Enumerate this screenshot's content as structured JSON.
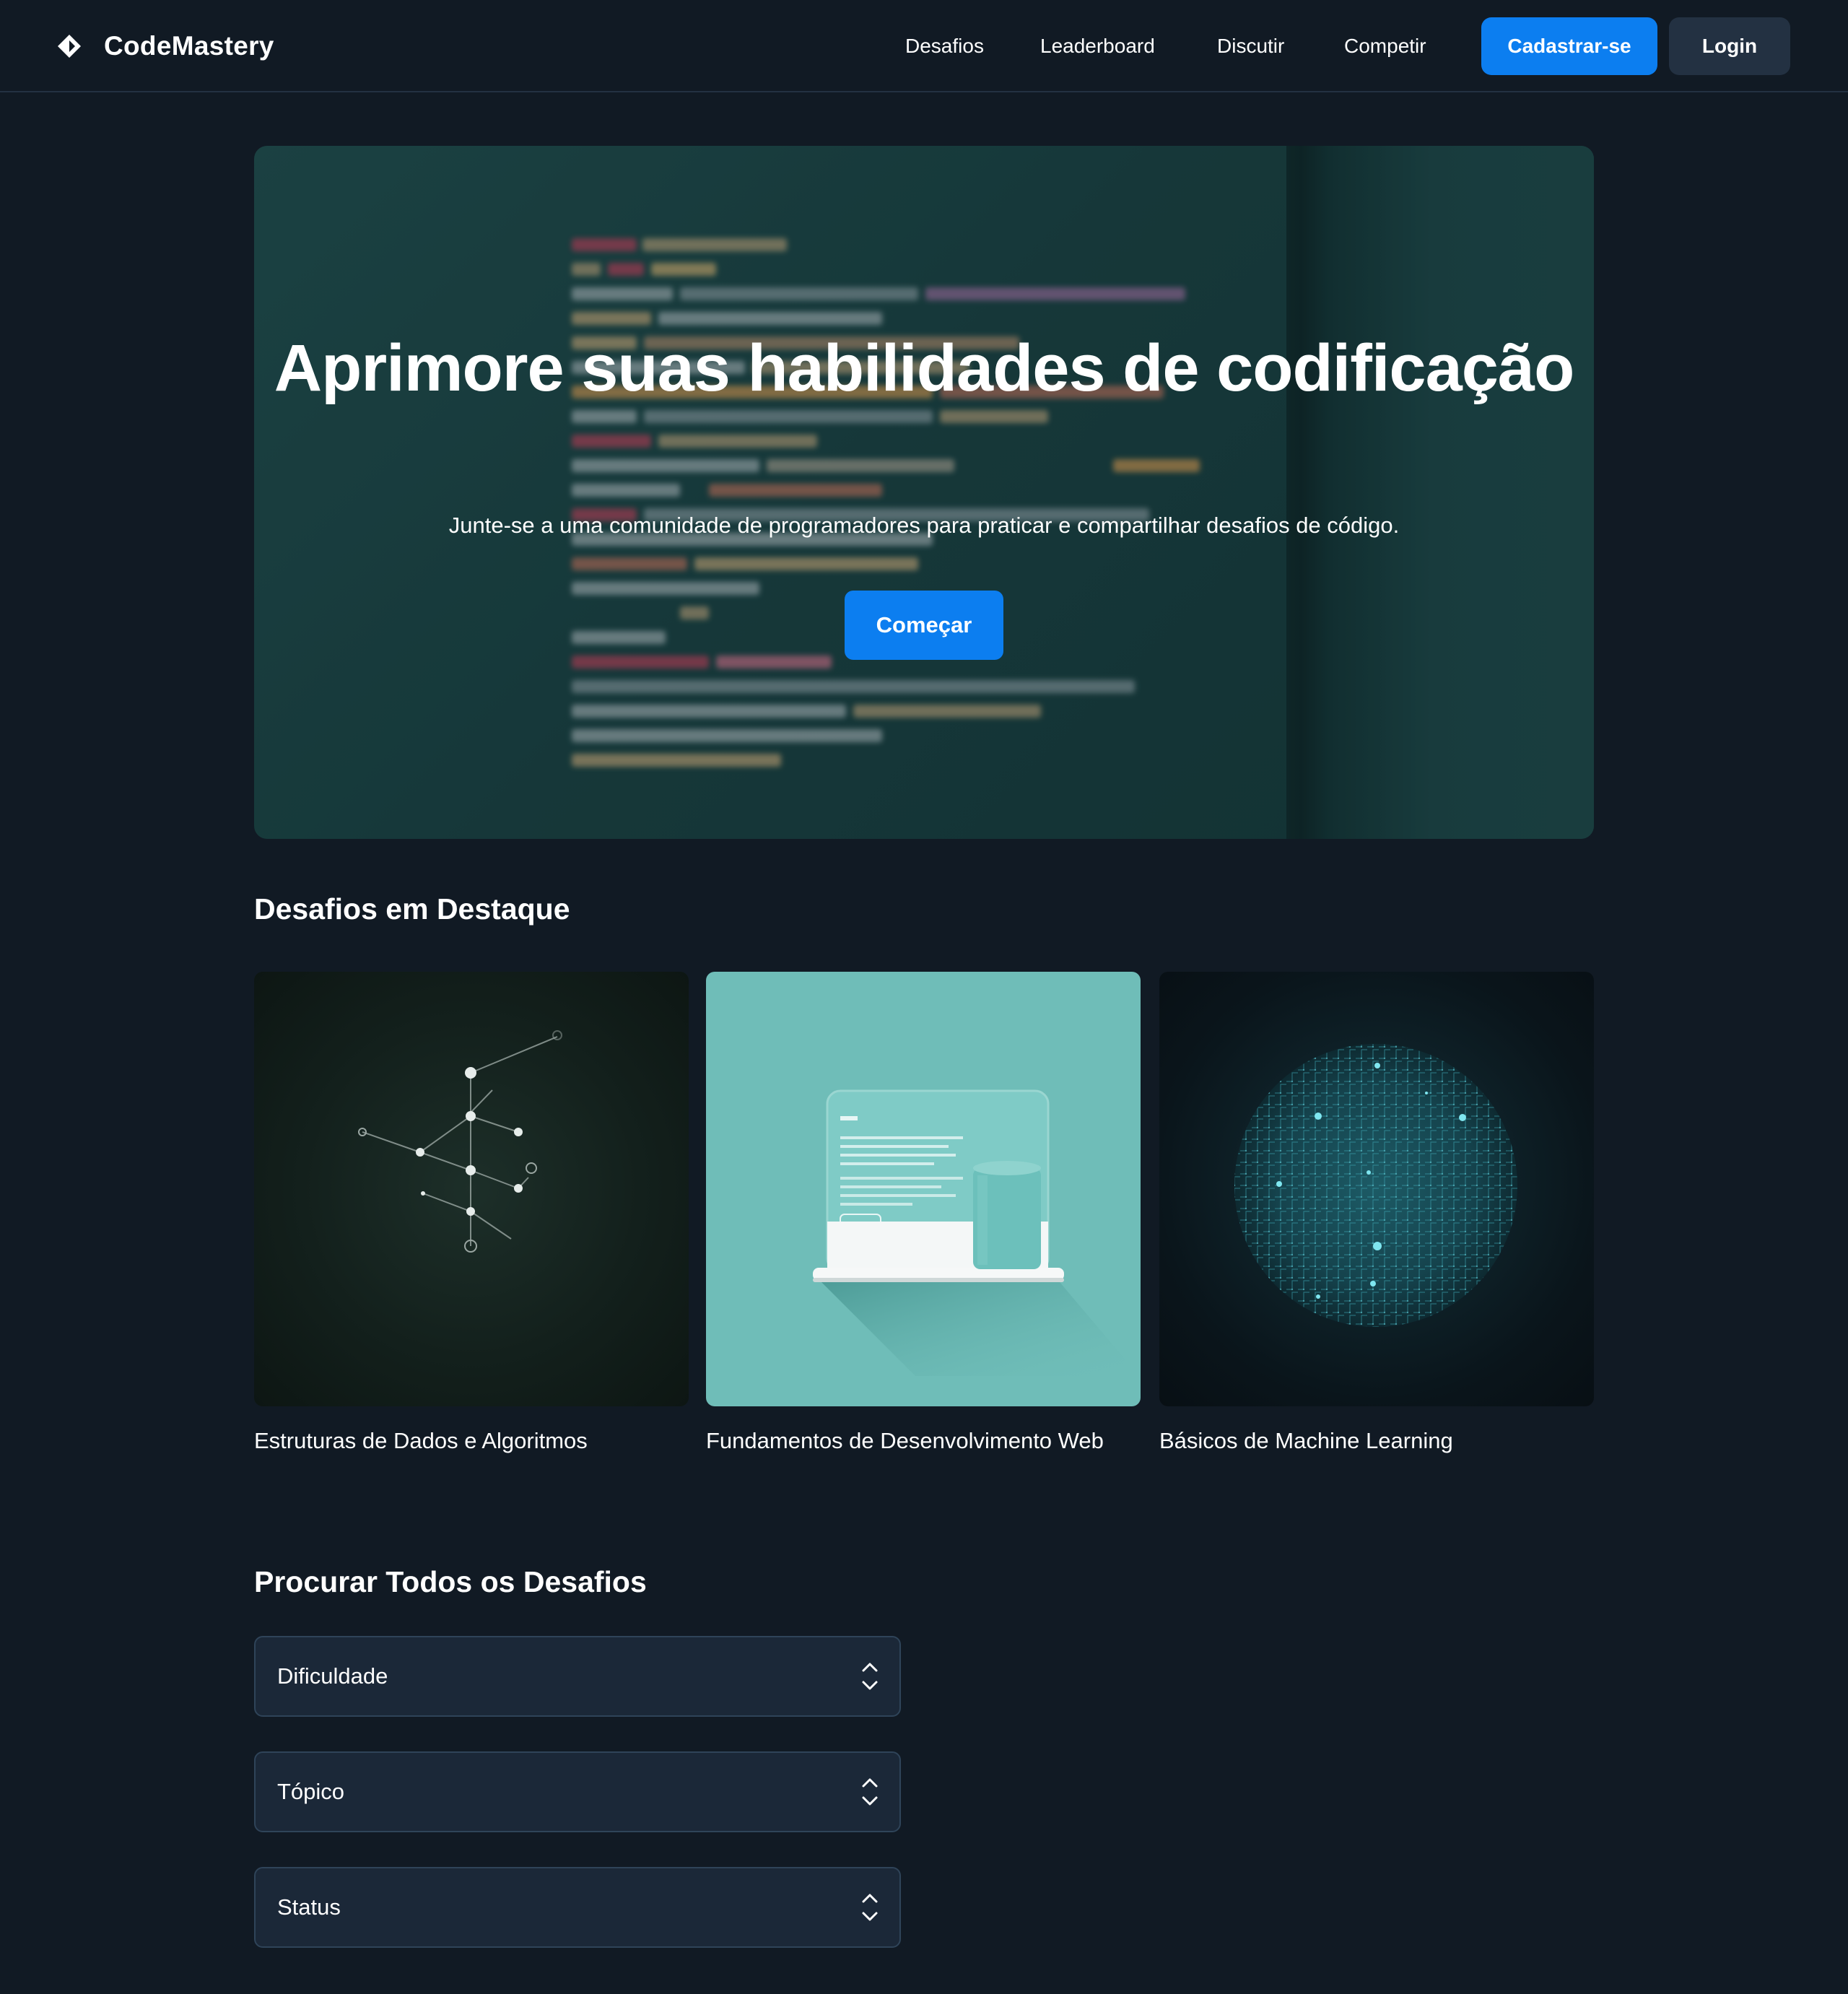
{
  "header": {
    "brand_name": "CodeMastery",
    "nav": [
      "Desafios",
      "Leaderboard",
      "Discutir",
      "Competir"
    ],
    "signup_label": "Cadastrar-se",
    "login_label": "Login"
  },
  "hero": {
    "title": "Aprimore suas habilidades de codificação",
    "subtitle": "Junte-se a uma comunidade de programadores para praticar e compartilhar desafios de código.",
    "cta_label": "Começar"
  },
  "featured": {
    "title": "Desafios em Destaque",
    "cards": [
      {
        "title": "Estruturas de Dados e Algoritmos",
        "image": "graph-network-illustration"
      },
      {
        "title": "Fundamentos de Desenvolvimento Web",
        "image": "web-device-illustration"
      },
      {
        "title": "Básicos de Machine Learning",
        "image": "circuit-sphere-illustration"
      }
    ]
  },
  "browse": {
    "title": "Procurar Todos os Desafios",
    "filters": [
      {
        "label": "Dificuldade"
      },
      {
        "label": "Tópico"
      },
      {
        "label": "Status"
      }
    ]
  },
  "colors": {
    "background": "#111a24",
    "accent": "#0c7ef0",
    "secondary_button": "#233142",
    "select_bg": "#1b2838"
  }
}
